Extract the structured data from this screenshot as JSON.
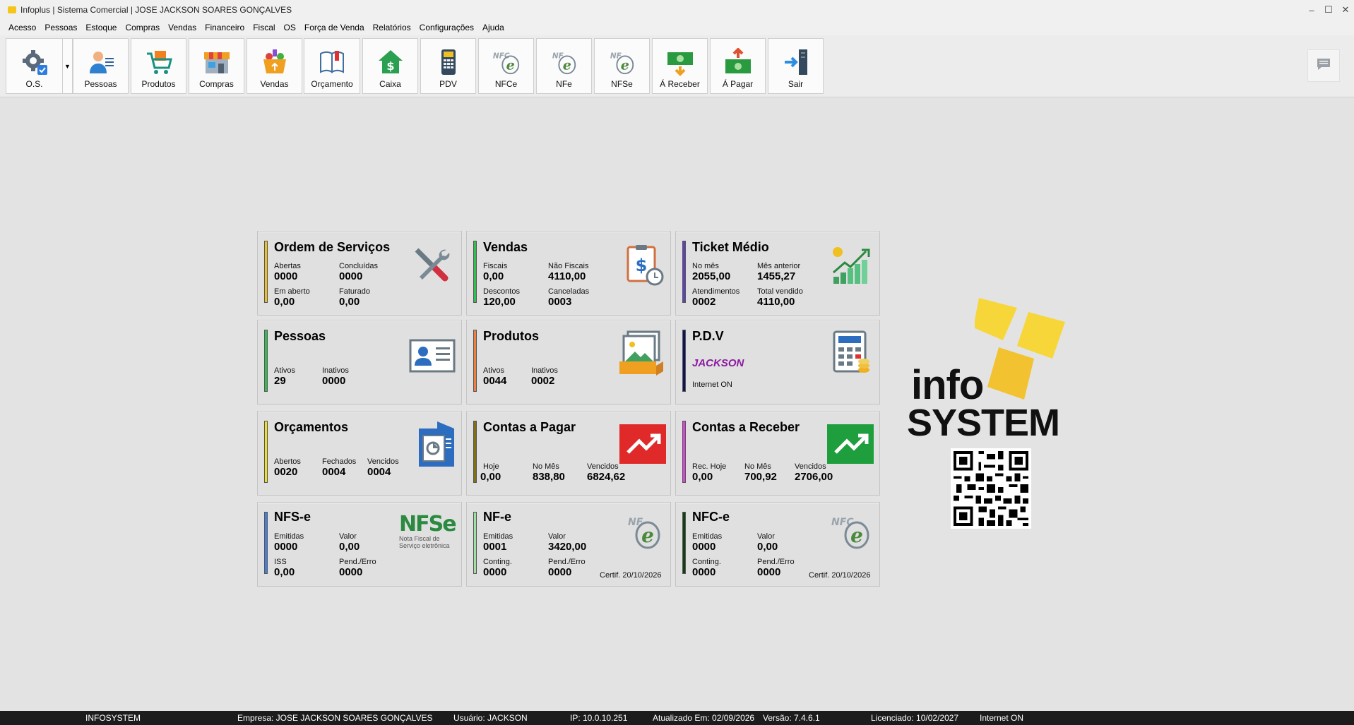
{
  "window": {
    "title": "Infoplus | Sistema Comercial | JOSE JACKSON SOARES GONÇALVES"
  },
  "menu": [
    "Acesso",
    "Pessoas",
    "Estoque",
    "Compras",
    "Vendas",
    "Financeiro",
    "Fiscal",
    "OS",
    "Força de Venda",
    "Relatórios",
    "Configurações",
    "Ajuda"
  ],
  "toolbar": {
    "buttons": [
      {
        "label": "O.S.",
        "icon": "gear-icon"
      },
      {
        "label": "Pessoas",
        "icon": "person-icon"
      },
      {
        "label": "Produtos",
        "icon": "cart-icon"
      },
      {
        "label": "Compras",
        "icon": "store-icon"
      },
      {
        "label": "Vendas",
        "icon": "basket-icon"
      },
      {
        "label": "Orçamento",
        "icon": "book-icon"
      },
      {
        "label": "Caixa",
        "icon": "cash-house-icon"
      },
      {
        "label": "PDV",
        "icon": "pos-terminal-icon"
      },
      {
        "label": "NFCe",
        "icon": "nfce-icon"
      },
      {
        "label": "NFe",
        "icon": "nfe-icon"
      },
      {
        "label": "NFSe",
        "icon": "nfse-icon"
      },
      {
        "label": "Á Receber",
        "icon": "money-down-icon"
      },
      {
        "label": "Á Pagar",
        "icon": "money-up-icon"
      },
      {
        "label": "Sair",
        "icon": "exit-icon"
      }
    ]
  },
  "cards": {
    "os": {
      "title": "Ordem de Serviços",
      "f1": "Abertas",
      "v1": "0000",
      "f2": "Concluídas",
      "v2": "0000",
      "f3": "Em aberto",
      "v3": "0,00",
      "f4": "Faturado",
      "v4": "0,00",
      "bar_color": "#f0c020"
    },
    "vendas": {
      "title": "Vendas",
      "f1": "Fiscais",
      "v1": "0,00",
      "f2": "Não Fiscais",
      "v2": "4110,00",
      "f3": "Descontos",
      "v3": "120,00",
      "f4": "Canceladas",
      "v4": "0003",
      "bar_color": "#30c050"
    },
    "ticket": {
      "title": "Ticket Médio",
      "f1": "No mês",
      "v1": "2055,00",
      "f2": "Mês anterior",
      "v2": "1455,27",
      "f3": "Atendimentos",
      "v3": "0002",
      "f4": "Total vendido",
      "v4": "4110,00",
      "bar_color": "#6040c0"
    },
    "pessoas": {
      "title": "Pessoas",
      "f1": "Ativos",
      "v1": "29",
      "f2": "Inativos",
      "v2": "0000",
      "bar_color": "#30c050"
    },
    "produtos": {
      "title": "Produtos",
      "f1": "Ativos",
      "v1": "0044",
      "f2": "Inativos",
      "v2": "0002",
      "bar_color": "#f08040"
    },
    "pdv": {
      "title": "P.D.V",
      "user": "JACKSON",
      "status": "Internet ON",
      "bar_color": "#101060",
      "user_color": "#8a1aa0"
    },
    "orcamentos": {
      "title": "Orçamentos",
      "f1": "Abertos",
      "v1": "0020",
      "f2": "Fechados",
      "v2": "0004",
      "f3": "Vencidos",
      "v3": "0004",
      "bar_color": "#f0e020"
    },
    "pagar": {
      "title": "Contas a Pagar",
      "f1": "Hoje",
      "v1": "0,00",
      "f2": "No Mês",
      "v2": "838,80",
      "f3": "Vencidos",
      "v3": "6824,62",
      "bar_color": "#807010"
    },
    "receber": {
      "title": "Contas a Receber",
      "f1": "Rec. Hoje",
      "v1": "0,00",
      "f2": "No Mês",
      "v2": "700,92",
      "f3": "Vencidos",
      "v3": "2706,00",
      "bar_color": "#e040e0"
    },
    "nfse": {
      "title": "NFS-e",
      "f1": "Emitidas",
      "v1": "0000",
      "f2": "Valor",
      "v2": "0,00",
      "f3": "ISS",
      "v3": "0,00",
      "f4": "Pend./Erro",
      "v4": "0000",
      "logo_text": "NFSe",
      "logo_sub1": "Nota Fiscal de",
      "logo_sub2": "Serviço eletrônica",
      "bar_color": "#4080e0"
    },
    "nfe": {
      "title": "NF-e",
      "f1": "Emitidas",
      "v1": "0001",
      "f2": "Valor",
      "v2": "3420,00",
      "f3": "Conting.",
      "v3": "0000",
      "f4": "Pend./Erro",
      "v4": "0000",
      "certif": "Certif. 20/10/2026",
      "bar_color": "#a0e0a0"
    },
    "nfce": {
      "title": "NFC-e",
      "f1": "Emitidas",
      "v1": "0000",
      "f2": "Valor",
      "v2": "0,00",
      "f3": "Conting.",
      "v3": "0000",
      "f4": "Pend./Erro",
      "v4": "0000",
      "certif": "Certif. 20/10/2026",
      "bar_color": "#104010"
    }
  },
  "logo": {
    "line1": "info",
    "line2": "SYSTEM"
  },
  "status": {
    "app": "INFOSYSTEM",
    "empresa": "Empresa: JOSE JACKSON SOARES GONÇALVES",
    "usuario": "Usuário: JACKSON",
    "ip": "IP: 10.0.10.251",
    "atualizado": "Atualizado Em: 02/09/2026",
    "versao": "Versão: 7.4.6.1",
    "licenciado": "Licenciado: 10/02/2027",
    "internet": "Internet ON"
  }
}
